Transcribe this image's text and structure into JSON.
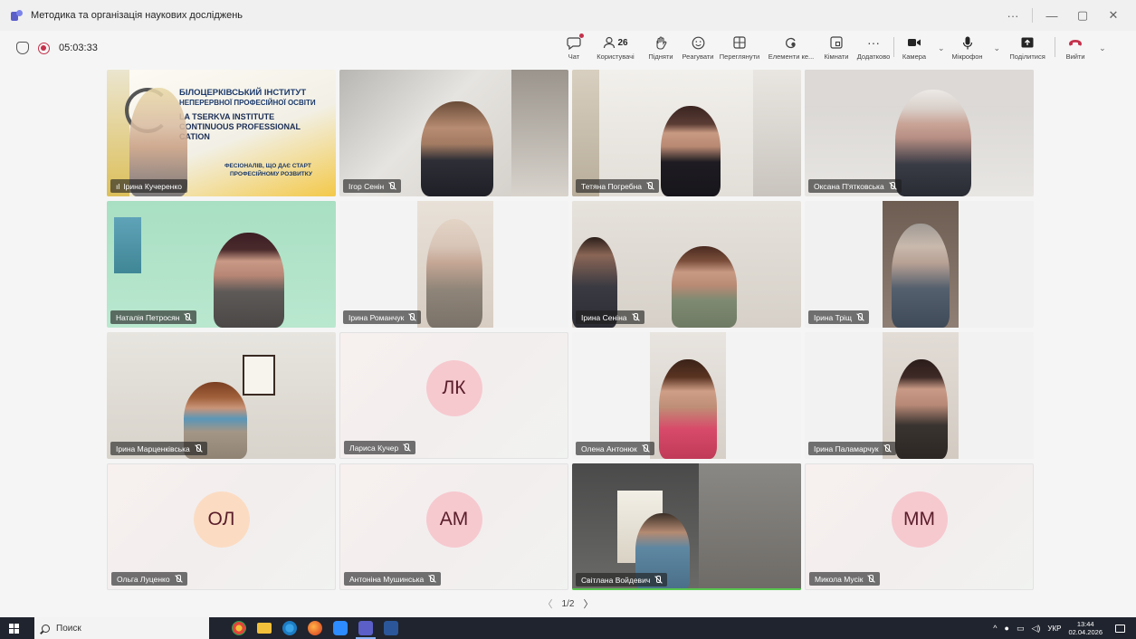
{
  "window": {
    "title": "Методика та організація наукових досліджень",
    "controls": [
      "···",
      "—",
      "▢",
      "✕"
    ]
  },
  "meeting": {
    "timer": "05:03:33",
    "participants_count": "26",
    "page_indicator": "1/2",
    "toolbar": {
      "chat": "Чат",
      "people": "Користувачі",
      "raise": "Підняти",
      "react": "Реагувати",
      "view": "Переглянути",
      "elements": "Елементи ке...",
      "rooms": "Кімнати",
      "more": "Додатково",
      "camera": "Камера",
      "mic": "Мікрофон",
      "share": "Поділитися",
      "leave": "Вийти"
    }
  },
  "institute_banner": {
    "ua_line1": "БІЛОЦЕРКІВСЬКИЙ ІНСТИТУТ",
    "ua_line2": "НЕПЕРЕРВНОЇ ПРОФЕСІЙНОЇ ОСВІТИ",
    "en_line1": "LA TSERKVA INSTITUTE",
    "en_line2": "CONTINUOUS PROFESSIONAL",
    "en_line3": "CATION",
    "slogan1": "ФЕСІОНАЛІВ, ЩО ДАЄ СТАРТ",
    "slogan2": "ПРОФЕСІЙНОМУ РОЗВИТКУ"
  },
  "participants": [
    {
      "name": "Ірина Кучеренко",
      "type": "video"
    },
    {
      "name": "Ігор Сенін",
      "type": "video"
    },
    {
      "name": "Тетяна Погребна",
      "type": "video"
    },
    {
      "name": "Оксана П'ятковська",
      "type": "video"
    },
    {
      "name": "Наталія Петросян",
      "type": "video"
    },
    {
      "name": "Ірина Романчук",
      "type": "video"
    },
    {
      "name": "Ірина Сеніна",
      "type": "video"
    },
    {
      "name": "Ірина Тріщ",
      "type": "video"
    },
    {
      "name": "Ірина Марценківська",
      "type": "video"
    },
    {
      "name": "Лариса Кучер",
      "type": "avatar",
      "initials": "ЛК",
      "color": "#f6c9cf"
    },
    {
      "name": "Олена Антонюк",
      "type": "video"
    },
    {
      "name": "Ірина Паламарчук",
      "type": "video"
    },
    {
      "name": "Ольга Луценко",
      "type": "avatar",
      "initials": "ОЛ",
      "color": "#fbdcc3"
    },
    {
      "name": "Антоніна Мушинська",
      "type": "avatar",
      "initials": "АМ",
      "color": "#f6c9cf"
    },
    {
      "name": "Світлана Войдевич",
      "type": "video"
    },
    {
      "name": "Микола Мусік",
      "type": "avatar",
      "initials": "ММ",
      "color": "#f6c9cf"
    }
  ],
  "taskbar": {
    "search_placeholder": "Поиск",
    "language": "УКР",
    "time": "13:44",
    "date": "02.04.2026"
  }
}
